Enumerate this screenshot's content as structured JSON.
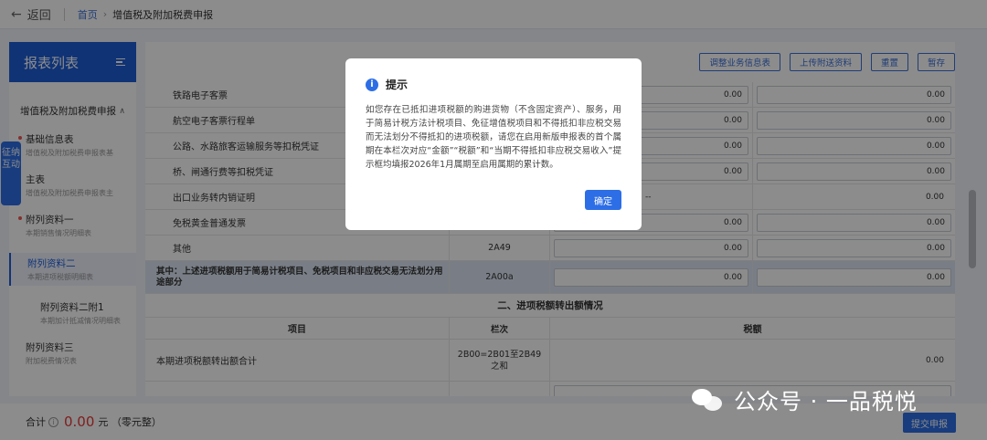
{
  "topbar": {
    "back_label": "返回",
    "crumb_home": "首页",
    "crumb_sep": "›",
    "crumb_current": "增值税及附加税费申报"
  },
  "sidebar": {
    "title": "报表列表",
    "group": "增值税及附加税费申报",
    "items": [
      {
        "title": "基础信息表",
        "sub": "增值税及附加税费申报表基",
        "dot": true
      },
      {
        "title": "主表",
        "sub": "增值税及附加税费申报表主",
        "dot": false
      },
      {
        "title": "附列资料一",
        "sub": "本期销售情况明细表",
        "dot": true
      },
      {
        "title": "附列资料二",
        "sub": "本期进项税额明细表",
        "dot": false
      },
      {
        "title": "附列资料二附1",
        "sub": "本期加计抵减情况明细表",
        "dot": false
      },
      {
        "title": "附列资料三",
        "sub": "附加税费情况表",
        "dot": false
      }
    ],
    "float_tab": "征纳互动"
  },
  "toolbar": {
    "btn1": "调整业务信息表",
    "btn2": "上传附送资料",
    "btn3": "重置",
    "btn4": "暂存"
  },
  "table": {
    "rows": [
      {
        "name": "铁路电子客票",
        "col": "",
        "v1": "0.00",
        "v2": "0.00"
      },
      {
        "name": "航空电子客票行程单",
        "col": "",
        "v1": "0.00",
        "v2": "0.00"
      },
      {
        "name": "公路、水路旅客运输服务等扣税凭证",
        "col": "",
        "v1": "0.00",
        "v2": "0.00"
      },
      {
        "name": "桥、闸通行费等扣税凭证",
        "col": "",
        "v1": "0.00",
        "v2": "0.00"
      },
      {
        "name": "出口业务转内销证明",
        "col": "",
        "v1": "--",
        "v2": "0.00"
      },
      {
        "name": "免税黄金普通发票",
        "col": "",
        "v1": "0.00",
        "v2": "0.00"
      },
      {
        "name": "其他",
        "col": "2A49",
        "v1": "0.00",
        "v2": "0.00"
      }
    ],
    "highlight_row": {
      "name": "其中：上述进项税额用于简易计税项目、免税项目和非应税交易无法划分用途部分",
      "col": "2A00a",
      "v1": "0.00",
      "v2": "0.00"
    },
    "section2_title": "二、进项税额转出额情况",
    "header": {
      "item": "项目",
      "col": "栏次",
      "tax": "税额"
    },
    "section2_rows": [
      {
        "name": "本期进项税额转出额合计",
        "col": "2B00=2B01至2B49之和",
        "tax": "0.00"
      }
    ]
  },
  "footer": {
    "total_label": "合计",
    "total_value": "0.00",
    "total_unit": "元 （零元整）",
    "submit": "提交申报"
  },
  "modal": {
    "title": "提示",
    "body": "如您存在已抵扣进项税额的购进货物（不含固定资产）、服务，用于简易计税方法计税项目、免征增值税项目和不得抵扣非应税交易而无法划分不得抵扣的进项税额，请您在启用新版申报表的首个属期在本栏次对应“金额”“税额”和“当期不得抵扣非应税交易收入”提示框均填报2026年1月属期至启用属期的累计数。",
    "ok": "确定"
  },
  "watermark": "公众号 · 一品税悦",
  "colors": {
    "primary": "#2d6ee6",
    "amount_red": "#e53935",
    "sidebar_header": "#1e5ed8"
  }
}
